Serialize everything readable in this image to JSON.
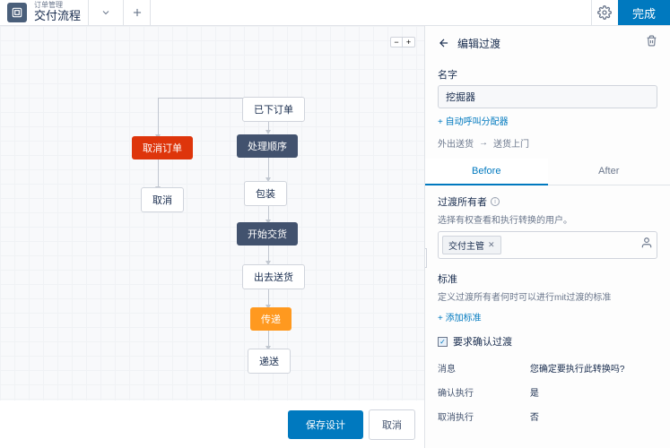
{
  "header": {
    "subtitle": "订单管理",
    "title": "交付流程",
    "done": "完成"
  },
  "nodes": {
    "placed": "已下订单",
    "cancel_order": "取消订单",
    "process": "处理顺序",
    "cancel": "取消",
    "packing": "包装",
    "start_deliver": "开始交货",
    "out_ship": "出去送货",
    "transfer": "传递",
    "deliver": "递送"
  },
  "footer": {
    "save": "保存设计",
    "cancel": "取消"
  },
  "panel": {
    "title": "编辑过渡",
    "name_label": "名字",
    "name_value": "挖掘器",
    "auto_dispatch": "+ 自动呼叫分配器",
    "from": "外出送货",
    "to": "送货上门",
    "tab_before": "Before",
    "tab_after": "After",
    "owner_label": "过渡所有者",
    "owner_help": "选择有权查看和执行转换的用户。",
    "owner_chip": "交付主管",
    "criteria_label": "标准",
    "criteria_help": "定义过渡所有者何时可以进行mit过渡的标准",
    "add_criteria": "+ 添加标准",
    "confirm_check": "要求确认过渡",
    "msg_label": "消息",
    "msg_value": "您确定要执行此转换吗?",
    "confirm_label": "确认执行",
    "confirm_value": "是",
    "cancel_label": "取消执行",
    "cancel_value": "否"
  }
}
